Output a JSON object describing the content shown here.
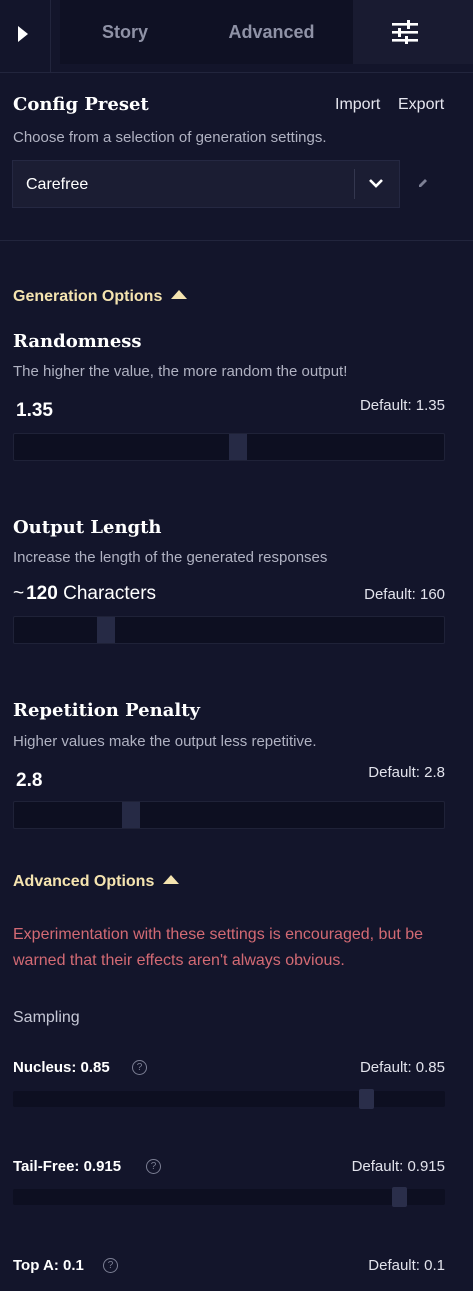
{
  "tabs": {
    "story": "Story",
    "advanced": "Advanced",
    "settings_icon": "sliders-icon",
    "toggle_icon": "play-icon"
  },
  "config_preset": {
    "title": "Config Preset",
    "import_label": "Import",
    "export_label": "Export",
    "description": "Choose from a selection of generation settings.",
    "selected": "Carefree"
  },
  "generation_options": {
    "header": "Generation Options",
    "randomness": {
      "title": "Randomness",
      "description": "The higher the value, the more random the output!",
      "value": "1.35",
      "default": "Default: 1.35",
      "fraction": 0.52
    },
    "output_length": {
      "title": "Output Length",
      "description": "Increase the length of the generated responses",
      "prefix": "~",
      "value": "120",
      "unit": "Characters",
      "default": "Default: 160",
      "fraction": 0.2
    },
    "repetition_penalty": {
      "title": "Repetition Penalty",
      "description": "Higher values make the output less repetitive.",
      "value": "2.8",
      "default": "Default: 2.8",
      "fraction": 0.26
    }
  },
  "advanced_options": {
    "header": "Advanced Options",
    "warning": "Experimentation with these settings is encouraged, but be warned that their effects aren't always obvious.",
    "sampling_label": "Sampling",
    "nucleus": {
      "label": "Nucleus:",
      "value": "0.85",
      "default": "Default: 0.85",
      "fraction": 0.83
    },
    "tail_free": {
      "label": "Tail-Free:",
      "value": "0.915",
      "default": "Default: 0.915",
      "fraction": 0.91
    },
    "top_a": {
      "label": "Top A:",
      "value": "0.1",
      "default": "Default: 0.1"
    }
  },
  "colors": {
    "background": "#13152b",
    "accent": "#f5e4b0",
    "warning": "#d36a74"
  }
}
